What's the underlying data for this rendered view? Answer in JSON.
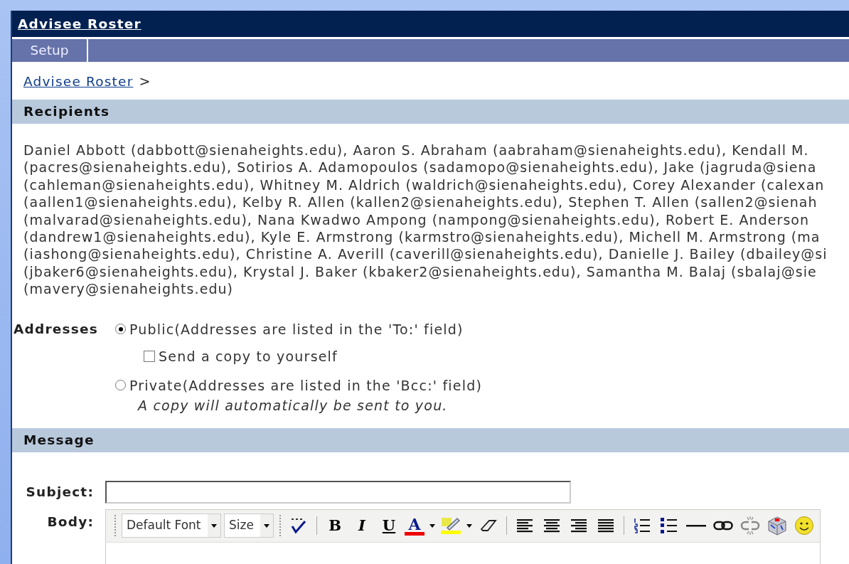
{
  "window": {
    "title": "Advisee Roster"
  },
  "tabs": [
    {
      "label": "Setup",
      "selected": false
    }
  ],
  "breadcrumb": {
    "link": "Advisee Roster",
    "separator": ">"
  },
  "recipients": {
    "heading": "Recipients",
    "lines": [
      "Daniel Abbott (dabbott@sienaheights.edu), Aaron S. Abraham (aabraham@sienaheights.edu), Kendall M.",
      "(pacres@sienaheights.edu), Sotirios A. Adamopoulos (sadamopo@sienaheights.edu), Jake (jagruda@siena",
      "(cahleman@sienaheights.edu), Whitney M. Aldrich (waldrich@sienaheights.edu), Corey Alexander (calexan",
      "(aallen1@sienaheights.edu), Kelby R. Allen (kallen2@sienaheights.edu), Stephen T. Allen (sallen2@sienah",
      "(malvarad@sienaheights.edu), Nana Kwadwo Ampong (nampong@sienaheights.edu), Robert E. Anderson",
      "(dandrew1@sienaheights.edu), Kyle E. Armstrong (karmstro@sienaheights.edu), Michell M. Armstrong (ma",
      "(iashong@sienaheights.edu), Christine A. Averill (caverill@sienaheights.edu), Danielle J. Bailey (dbailey@si",
      "(jbaker6@sienaheights.edu), Krystal J. Baker (kbaker2@sienaheights.edu), Samantha M. Balaj (sbalaj@sie",
      "(mavery@sienaheights.edu)"
    ]
  },
  "addresses": {
    "label": "Addresses",
    "options": [
      {
        "label": "Public(Addresses are listed in the 'To:' field)",
        "selected": true,
        "sub_checkbox": {
          "label": "Send a copy to yourself",
          "checked": false
        }
      },
      {
        "label": "Private(Addresses are listed in the 'Bcc:' field)",
        "selected": false,
        "note": "A copy will automatically be sent to you."
      }
    ]
  },
  "message": {
    "heading": "Message",
    "subject_label": "Subject:",
    "body_label": "Body:",
    "toolbar": {
      "font_select": "Default Font",
      "size_select": "Size",
      "format_buttons": [
        "B",
        "I",
        "U"
      ],
      "font_color_letter": "A"
    }
  }
}
